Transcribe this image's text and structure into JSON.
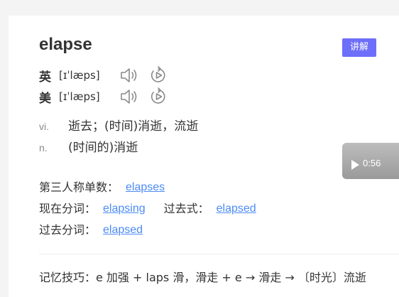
{
  "entry": {
    "word": "elapse",
    "explain_button": "讲解"
  },
  "pronunciations": [
    {
      "lang": "英",
      "phonetic": "[ɪˈlæps]"
    },
    {
      "lang": "美",
      "phonetic": "[ɪˈlæps]"
    }
  ],
  "definitions": [
    {
      "pos": "vi.",
      "meaning": "逝去；(时间)消逝，流逝"
    },
    {
      "pos": "n.",
      "meaning": "(时间的)消逝"
    }
  ],
  "video": {
    "duration": "0:56"
  },
  "forms": {
    "third_person": {
      "label": "第三人称单数：",
      "value": "elapses"
    },
    "present_participle": {
      "label": "现在分词：",
      "value": "elapsing"
    },
    "past_tense": {
      "label": "过去式：",
      "value": "elapsed"
    },
    "past_participle": {
      "label": "过去分词：",
      "value": "elapsed"
    }
  },
  "mnemonic": "记忆技巧：e 加强 + laps 滑，滑走 + e → 滑走 → 〔时光〕流逝",
  "colors": {
    "accent": "#6d6ef9",
    "link": "#4c8bf5",
    "icon": "#8a8a8a"
  },
  "icons": {
    "speaker": "speaker-icon",
    "replay": "replay-icon",
    "play": "play-icon"
  }
}
